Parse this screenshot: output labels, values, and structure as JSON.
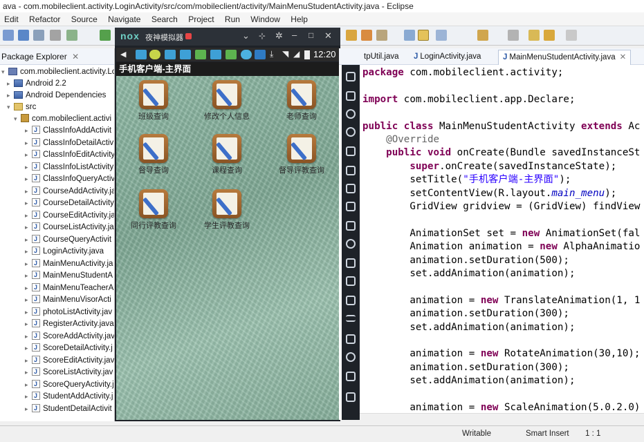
{
  "window": {
    "title": "ava - com.mobileclient.activity.LoginActivity/src/com/mobileclient/activity/MainMenuStudentActivity.java - Eclipse"
  },
  "menu": [
    "Edit",
    "Refactor",
    "Source",
    "Navigate",
    "Search",
    "Project",
    "Run",
    "Window",
    "Help"
  ],
  "explorer": {
    "title": "Package Explorer",
    "project": "com.mobileclient.activity.Login",
    "android_lib": "Android 2.2",
    "android_deps": "Android Dependencies",
    "src": "src",
    "package": "com.mobileclient.activi",
    "files": [
      "ClassInfoAddActivit",
      "ClassInfoDetailActiv",
      "ClassInfoEditActivity",
      "ClassInfoListActivity",
      "ClassInfoQueryActiv",
      "CourseAddActivity.ja",
      "CourseDetailActivity",
      "CourseEditActivity.ja",
      "CourseListActivity.ja",
      "CourseQueryActivit",
      "LoginActivity.java",
      "MainMenuActivity.ja",
      "MainMenuStudentA",
      "MainMenuTeacherA",
      "MainMenuVisorActi",
      "photoListActivity.jav",
      "RegisterActivity.java",
      "ScoreAddActivity.jav",
      "ScoreDetailActivity.j",
      "ScoreEditActivity.jav",
      "ScoreListActivity.jav",
      "ScoreQueryActivity.j",
      "StudentAddActivity.j",
      "StudentDetailActivit"
    ]
  },
  "tabs": [
    {
      "label": "tpUtil.java"
    },
    {
      "label": "LoginActivity.java"
    },
    {
      "label": "MainMenuStudentActivity.java"
    }
  ],
  "code": [
    [
      {
        "t": "package",
        "c": "kw"
      },
      {
        "t": " com.mobileclient.activity;",
        "c": ""
      }
    ],
    [],
    [
      {
        "t": "import",
        "c": "kw"
      },
      {
        "t": " com.mobileclient.app.Declare;",
        "c": ""
      }
    ],
    [],
    [
      {
        "t": "public class",
        "c": "kw"
      },
      {
        "t": " MainMenuStudentActivity ",
        "c": ""
      },
      {
        "t": "extends",
        "c": "kw"
      },
      {
        "t": " Ac",
        "c": ""
      }
    ],
    [
      {
        "t": "    @Override",
        "c": "ann"
      }
    ],
    [
      {
        "t": "    ",
        "c": ""
      },
      {
        "t": "public void",
        "c": "kw"
      },
      {
        "t": " onCreate(Bundle savedInstanceSt",
        "c": ""
      }
    ],
    [
      {
        "t": "        ",
        "c": ""
      },
      {
        "t": "super",
        "c": "kw"
      },
      {
        "t": ".onCreate(savedInstanceState);",
        "c": ""
      }
    ],
    [
      {
        "t": "        setTitle(",
        "c": ""
      },
      {
        "t": "\"手机客户端-主界面\"",
        "c": "str"
      },
      {
        "t": ");",
        "c": ""
      }
    ],
    [
      {
        "t": "        setContentView(R.layout.",
        "c": ""
      },
      {
        "t": "main_menu",
        "c": "it"
      },
      {
        "t": ");",
        "c": ""
      }
    ],
    [
      {
        "t": "        GridView gridview = (GridView) findView",
        "c": ""
      }
    ],
    [],
    [
      {
        "t": "        AnimationSet set = ",
        "c": ""
      },
      {
        "t": "new",
        "c": "kw"
      },
      {
        "t": " AnimationSet(fal",
        "c": ""
      }
    ],
    [
      {
        "t": "        Animation animation = ",
        "c": ""
      },
      {
        "t": "new",
        "c": "kw"
      },
      {
        "t": " AlphaAnimatio",
        "c": ""
      }
    ],
    [
      {
        "t": "        animation.setDuration(500);",
        "c": ""
      }
    ],
    [
      {
        "t": "        set.addAnimation(animation);",
        "c": ""
      }
    ],
    [],
    [
      {
        "t": "        animation = ",
        "c": ""
      },
      {
        "t": "new",
        "c": "kw"
      },
      {
        "t": " TranslateAnimation(1, 1",
        "c": ""
      }
    ],
    [
      {
        "t": "        animation.setDuration(300);",
        "c": ""
      }
    ],
    [
      {
        "t": "        set.addAnimation(animation);",
        "c": ""
      }
    ],
    [],
    [
      {
        "t": "        animation = ",
        "c": ""
      },
      {
        "t": "new",
        "c": "kw"
      },
      {
        "t": " RotateAnimation(30,10);",
        "c": ""
      }
    ],
    [
      {
        "t": "        animation.setDuration(300);",
        "c": ""
      }
    ],
    [
      {
        "t": "        set.addAnimation(animation);",
        "c": ""
      }
    ],
    [],
    [
      {
        "t": "        animation = ",
        "c": ""
      },
      {
        "t": "new",
        "c": "kw"
      },
      {
        "t": " ScaleAnimation(5.0.2.0)",
        "c": ""
      }
    ]
  ],
  "emulator": {
    "brand": "nox",
    "title": "夜神模拟器",
    "time": "12:20",
    "app_title": "手机客户端-主界面",
    "apps": [
      "班级查询",
      "修改个人信息",
      "老师查询",
      "督导查询",
      "课程查询",
      "督导评教查询",
      "同行评教查询",
      "学生评教查询"
    ]
  },
  "status": {
    "writable": "Writable",
    "insert": "Smart Insert",
    "position": "1 : 1"
  },
  "colors": {
    "keyword": "#7f0055",
    "string": "#2a00ff",
    "annotation": "#646464",
    "emulator_bg": "#1e2228",
    "nox_accent": "#3ea0d6"
  }
}
